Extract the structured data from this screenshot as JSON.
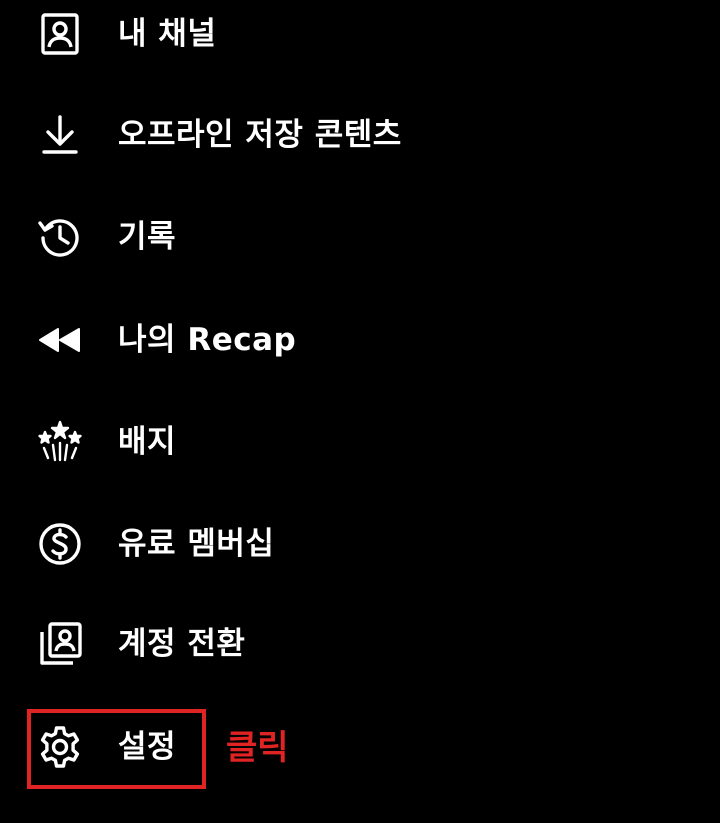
{
  "menu": {
    "items": [
      {
        "label": "내 채널",
        "icon": "account-box-icon"
      },
      {
        "label": "오프라인 저장 콘텐츠",
        "icon": "download-icon"
      },
      {
        "label": "기록",
        "icon": "history-icon"
      },
      {
        "label": "나의 Recap",
        "icon": "rewind-icon"
      },
      {
        "label": "배지",
        "icon": "badge-sparkle-icon"
      },
      {
        "label": "유료 멤버십",
        "icon": "dollar-circle-icon"
      },
      {
        "label": "계정 전환",
        "icon": "switch-account-icon"
      },
      {
        "label": "설정",
        "icon": "gear-icon"
      }
    ]
  },
  "annotation": {
    "text": "클릭",
    "color": "#e02424"
  },
  "colors": {
    "background": "#000000",
    "text": "#ffffff",
    "highlight": "#e02424"
  }
}
